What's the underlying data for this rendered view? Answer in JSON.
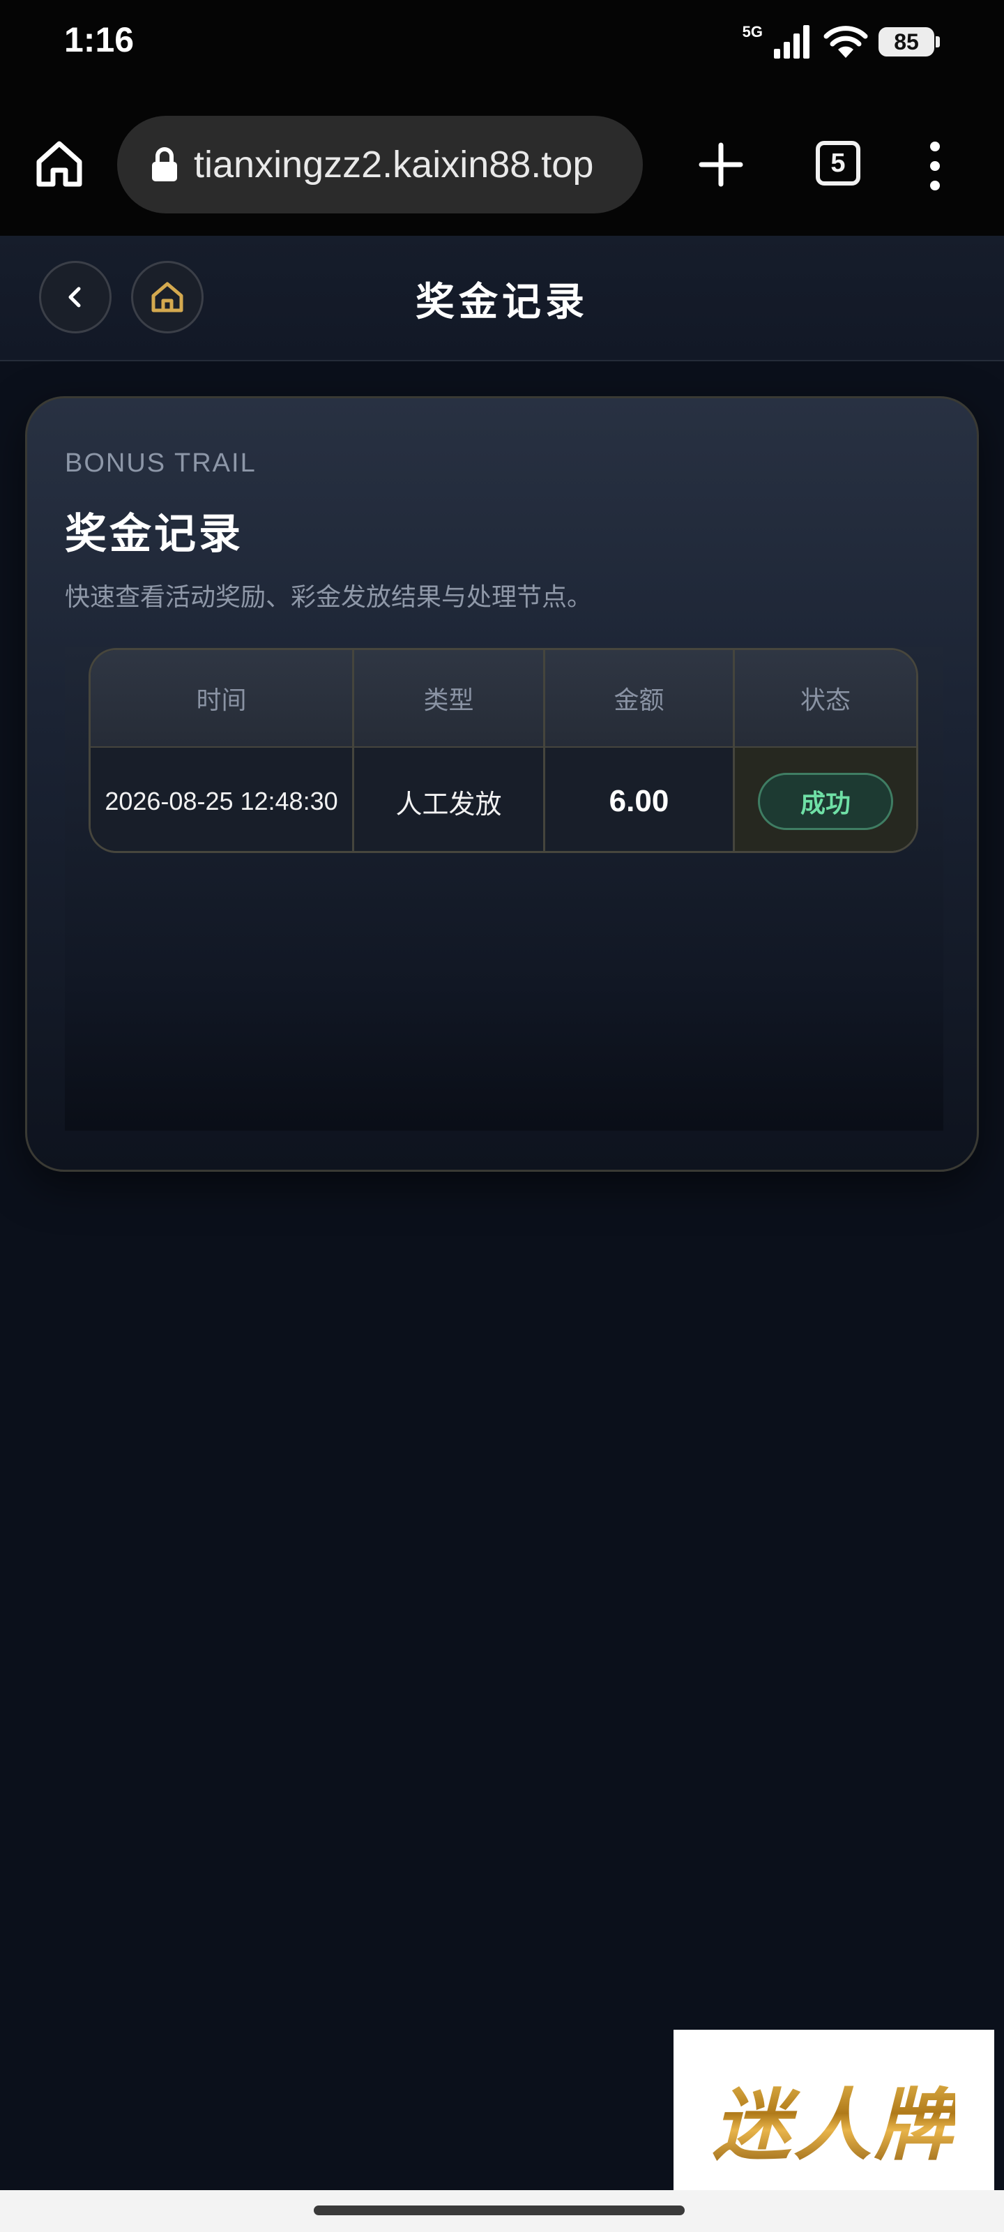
{
  "status_bar": {
    "time": "1:16",
    "network": "5G",
    "battery": "85"
  },
  "browser": {
    "url": "tianxingzz2.kaixin88.top",
    "tab_count": "5",
    "icons": [
      "home-icon",
      "lock-icon",
      "plus-icon",
      "tabs-icon",
      "kebab-menu-icon"
    ]
  },
  "header": {
    "title": "奖金记录",
    "icons": [
      "back-chevron-icon",
      "home-icon"
    ],
    "accent_color": "#d4a94f"
  },
  "card": {
    "eyebrow": "BONUS TRAIL",
    "title": "奖金记录",
    "description": "快速查看活动奖励、彩金发放结果与处理节点。",
    "table": {
      "columns": [
        "时间",
        "类型",
        "金额",
        "状态"
      ],
      "rows": [
        {
          "time": "2026-08-25 12:48:30",
          "type": "人工发放",
          "amount": "6.00",
          "status": "成功"
        }
      ]
    },
    "status_color": "#6fe0a6"
  },
  "watermark": {
    "text": "迷人牌"
  }
}
